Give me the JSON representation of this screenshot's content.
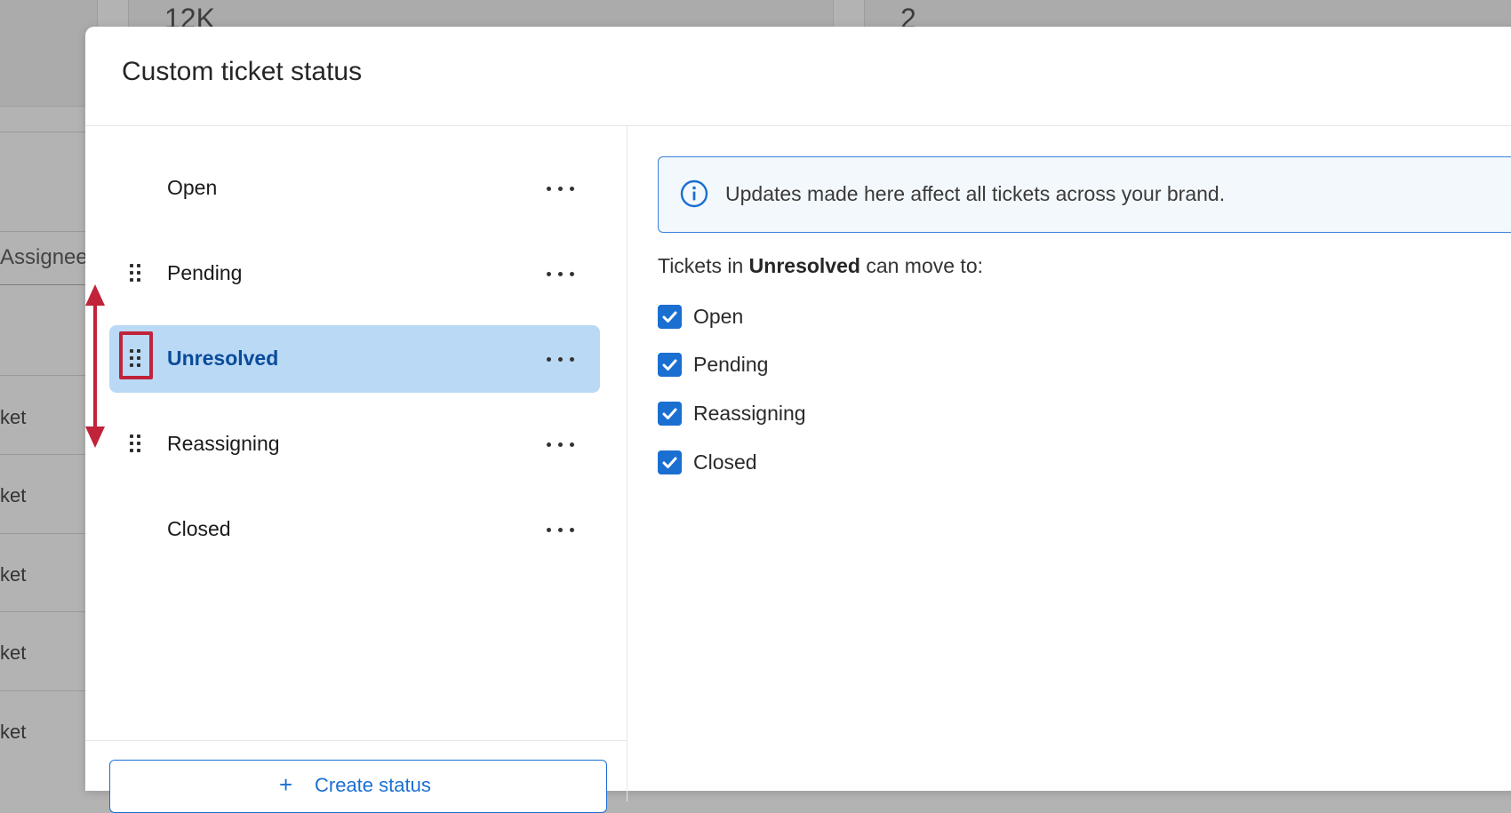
{
  "background": {
    "metric_a": "12K",
    "metric_b": "2",
    "column_header": "Assignee",
    "row_fragments": [
      "ket",
      "ket",
      "ket",
      "ket",
      "ket"
    ]
  },
  "modal": {
    "title": "Custom ticket status",
    "statuses": [
      {
        "label": "Open",
        "draggable": false,
        "selected": false
      },
      {
        "label": "Pending",
        "draggable": true,
        "selected": false
      },
      {
        "label": "Unresolved",
        "draggable": true,
        "selected": true
      },
      {
        "label": "Reassigning",
        "draggable": true,
        "selected": false
      },
      {
        "label": "Closed",
        "draggable": false,
        "selected": false
      }
    ],
    "create_button_label": "Create status",
    "info_banner": "Updates made here affect all tickets across your brand.",
    "moves_prefix": "Tickets in",
    "moves_status": "Unresolved",
    "moves_suffix": "can move to:",
    "transitions": [
      {
        "label": "Open",
        "checked": true
      },
      {
        "label": "Pending",
        "checked": true
      },
      {
        "label": "Reassigning",
        "checked": true
      },
      {
        "label": "Closed",
        "checked": true
      }
    ]
  },
  "colors": {
    "accent": "#1a6fd1",
    "selected_bg": "#bad9f5",
    "annotation": "#c0233a"
  }
}
